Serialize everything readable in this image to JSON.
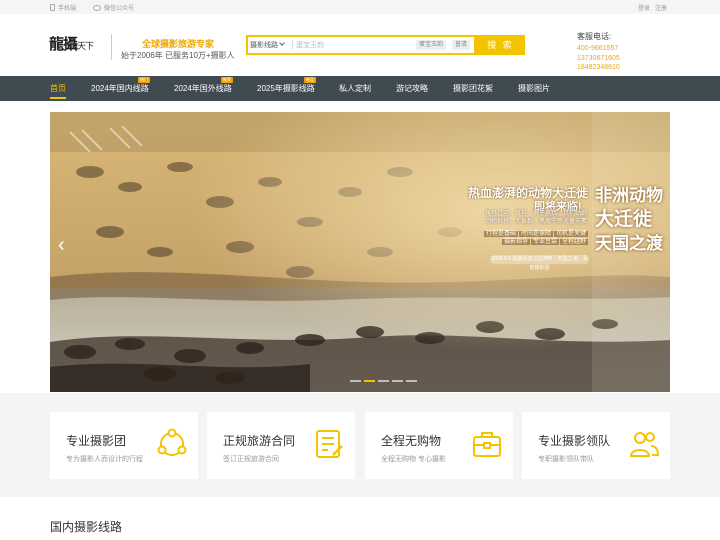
{
  "topbar": {
    "mobile": "手机端",
    "wechat": "微信公众号",
    "login": "登录",
    "register": "注册"
  },
  "header": {
    "logo_main": "龍攝",
    "logo_sub": "天下",
    "slogan": "全球摄影旅游专家",
    "since": "始于2006年  已服务10万+摄影人"
  },
  "search": {
    "category": "摄影线路",
    "placeholder": "蛋宝玉韵",
    "hot_tags": [
      "蛋宝玉韵",
      "普清"
    ],
    "button": "搜 索"
  },
  "service": {
    "label": "客服电话:",
    "phones": [
      "400-9661557",
      "13730671605",
      "18482348610"
    ]
  },
  "nav": {
    "items": [
      {
        "label": "首页",
        "badge": ""
      },
      {
        "label": "2024年国内线路",
        "badge": "热门"
      },
      {
        "label": "2024年国外线路",
        "badge": "推荐"
      },
      {
        "label": "2025年摄影线路",
        "badge": "新品"
      },
      {
        "label": "私人定制",
        "badge": ""
      },
      {
        "label": "游记攻略",
        "badge": ""
      },
      {
        "label": "摄影团花絮",
        "badge": ""
      },
      {
        "label": "摄影图片",
        "badge": ""
      }
    ]
  },
  "banner": {
    "headline": "热血澎湃的动物大迁徙",
    "subline": "即将来临!",
    "lines": [
      "角马过河、斑马、狮子捕猎、猎豹姑娘",
      "动物群移、大象群、黑犀牛等海量元素"
    ],
    "tags": [
      "行程是基础",
      "时间是保障",
      "司机是关键",
      "摄影指导",
      "专业豆袋",
      "全程越野"
    ],
    "stamp": "2024.9.5 坦桑尼亚马拉河畔「天国之渡」深度摄影团",
    "title_lines": [
      "非洲动物",
      "大迁徙",
      "天国之渡"
    ],
    "slide_count": 5,
    "active_slide": 1
  },
  "features": [
    {
      "title": "专业摄影团",
      "desc": "专为摄影人而设计的行程",
      "icon": "share-circle-icon"
    },
    {
      "title": "正规旅游合同",
      "desc": "签订正规旅游合同",
      "icon": "contract-icon"
    },
    {
      "title": "全程无购物",
      "desc": "全程无购物 专心摄影",
      "icon": "briefcase-icon"
    },
    {
      "title": "专业摄影领队",
      "desc": "专职摄影领队带队",
      "icon": "people-icon"
    }
  ],
  "section": {
    "title": "国内摄影线路"
  },
  "colors": {
    "accent": "#f3c400",
    "nav_bg": "#404a51",
    "phone": "#f0a800"
  }
}
